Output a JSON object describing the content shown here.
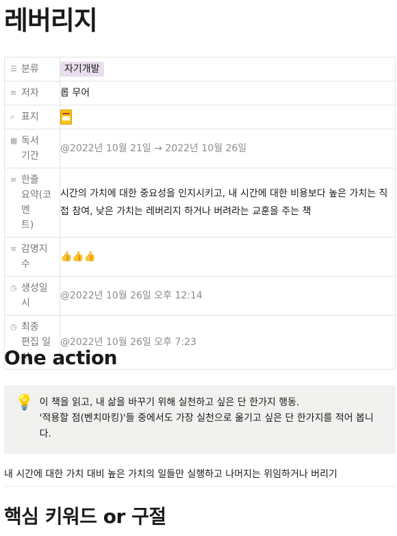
{
  "page": {
    "title": "레버리지"
  },
  "properties": [
    {
      "icon": "list-icon",
      "icon_glyph": "☰",
      "key": "분류",
      "value": "자기개발",
      "type": "tag"
    },
    {
      "icon": "text-icon",
      "icon_glyph": "≡",
      "key": "저자",
      "value": "롭 무어",
      "type": "text"
    },
    {
      "icon": "paperclip-icon",
      "icon_glyph": "⌕",
      "key": "표지",
      "value": "",
      "type": "file"
    },
    {
      "icon": "calendar-icon",
      "icon_glyph": "▦",
      "key": "독서\n기간",
      "value": "@2022년 10월 21일 → 2022년 10월 26일",
      "type": "date"
    },
    {
      "icon": "text-icon",
      "icon_glyph": "≡",
      "key": "한줄\n요약(코멘\n트)",
      "value": "시간의 가치에 대한 중요성을 인지시키고, 내 시간에 대한 비용보다 높은 가치는 직접 참여, 낮은 가치는 레버리지 하거나 버려라는 교훈을 주는 책",
      "type": "text"
    },
    {
      "icon": "text-icon",
      "icon_glyph": "≡",
      "key": "감명지\n수",
      "value": "👍👍👍",
      "type": "text"
    },
    {
      "icon": "clock-icon",
      "icon_glyph": "◷",
      "key": "생성일\n시",
      "value": "@2022년 10월 26일 오후 12:14",
      "type": "date"
    },
    {
      "icon": "clock-icon",
      "icon_glyph": "◷",
      "key": "최종\n편집 일시",
      "value": "@2022년 10월 26일 오후 7:23",
      "type": "date"
    }
  ],
  "sections": {
    "one_action_heading": "One action",
    "callout": {
      "icon": "lightbulb-icon",
      "line1": "이 책을 읽고, 내 삶을 바꾸기 위해 실천하고 싶은 단 한가지 행동.",
      "line2": "'적용할 점(벤치마킹)'들 중에서도 가장 실천으로 옮기고 싶은 단 한가지를 적어 봅니다."
    },
    "one_action_text": "내 시간에 대한 가치 대비 높은 가치의 일들만 실행하고 나머지는 위임하거나 버리기",
    "keywords_heading": "핵심 키워드 or 구절"
  }
}
